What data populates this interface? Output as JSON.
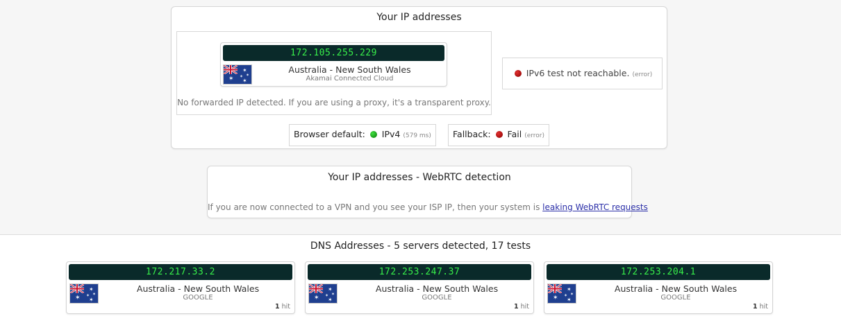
{
  "ip_card": {
    "title": "Your IP addresses",
    "ipv4": {
      "ip": "172.105.255.229",
      "location": "Australia - New South Wales",
      "isp": "Akamai Connected Cloud"
    },
    "forwarded_note": "No forwarded IP detected. If you are using a proxy, it's a transparent proxy.",
    "ipv6": {
      "text": "IPv6 test not reachable.",
      "status": "(error)"
    },
    "browser_default": {
      "label": "Browser default:",
      "value": "IPv4",
      "timing": "(579 ms)"
    },
    "fallback": {
      "label": "Fallback:",
      "value": "Fail",
      "status": "(error)"
    }
  },
  "webrtc_card": {
    "title": "Your IP addresses - WebRTC detection",
    "note_text": "If you are now connected to a VPN and you see your ISP IP, then your system is",
    "note_link": "leaking WebRTC requests"
  },
  "dns": {
    "title": "DNS Addresses - 5 servers detected, 17 tests",
    "servers": [
      {
        "ip": "172.217.33.2",
        "location": "Australia - New South Wales",
        "isp": "GOOGLE",
        "hits_count": "1",
        "hits_label": "hit"
      },
      {
        "ip": "172.253.247.37",
        "location": "Australia - New South Wales",
        "isp": "GOOGLE",
        "hits_count": "1",
        "hits_label": "hit"
      },
      {
        "ip": "172.253.204.1",
        "location": "Australia - New South Wales",
        "isp": "GOOGLE",
        "hits_count": "1",
        "hits_label": "hit"
      }
    ]
  },
  "colors": {
    "ip_bar_bg": "#0a2a2a",
    "ip_text": "#38f04a",
    "error_dot": "#c21a1a",
    "ok_dot": "#1ab01a",
    "link": "#2b2fa8"
  },
  "icons": {
    "flag": "australia-flag-icon",
    "error": "red-dot-icon",
    "ok": "green-dot-icon"
  }
}
